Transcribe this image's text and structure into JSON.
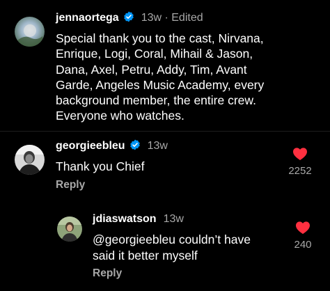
{
  "comments": [
    {
      "username": "jennaortega",
      "verified": true,
      "meta": "13w · Edited",
      "text_lines": [
        "Special thank you to the cast, Nirvana,",
        "Enrique, Logi, Coral, Mihail & Jason,",
        "Dana, Axel, Petru, Addy, Tim, Avant",
        "Garde, Angeles Music Academy, every",
        "background member, the entire crew.",
        "Everyone who watches."
      ]
    },
    {
      "username": "georgieebleu",
      "verified": true,
      "meta": "13w",
      "text_lines": [
        "Thank you Chief"
      ],
      "reply_label": "Reply",
      "likes": "2252",
      "liked": true
    },
    {
      "username": "jdiaswatson",
      "verified": false,
      "meta": "13w",
      "text_lines": [
        "@georgieebleu couldn’t have",
        "said it better myself"
      ],
      "reply_label": "Reply",
      "likes": "240",
      "liked": true
    }
  ],
  "colors": {
    "background": "#000000",
    "text": "#ffffff",
    "muted": "#a8a8a8",
    "verified_blue": "#0095f6",
    "heart_red": "#ff3040"
  }
}
